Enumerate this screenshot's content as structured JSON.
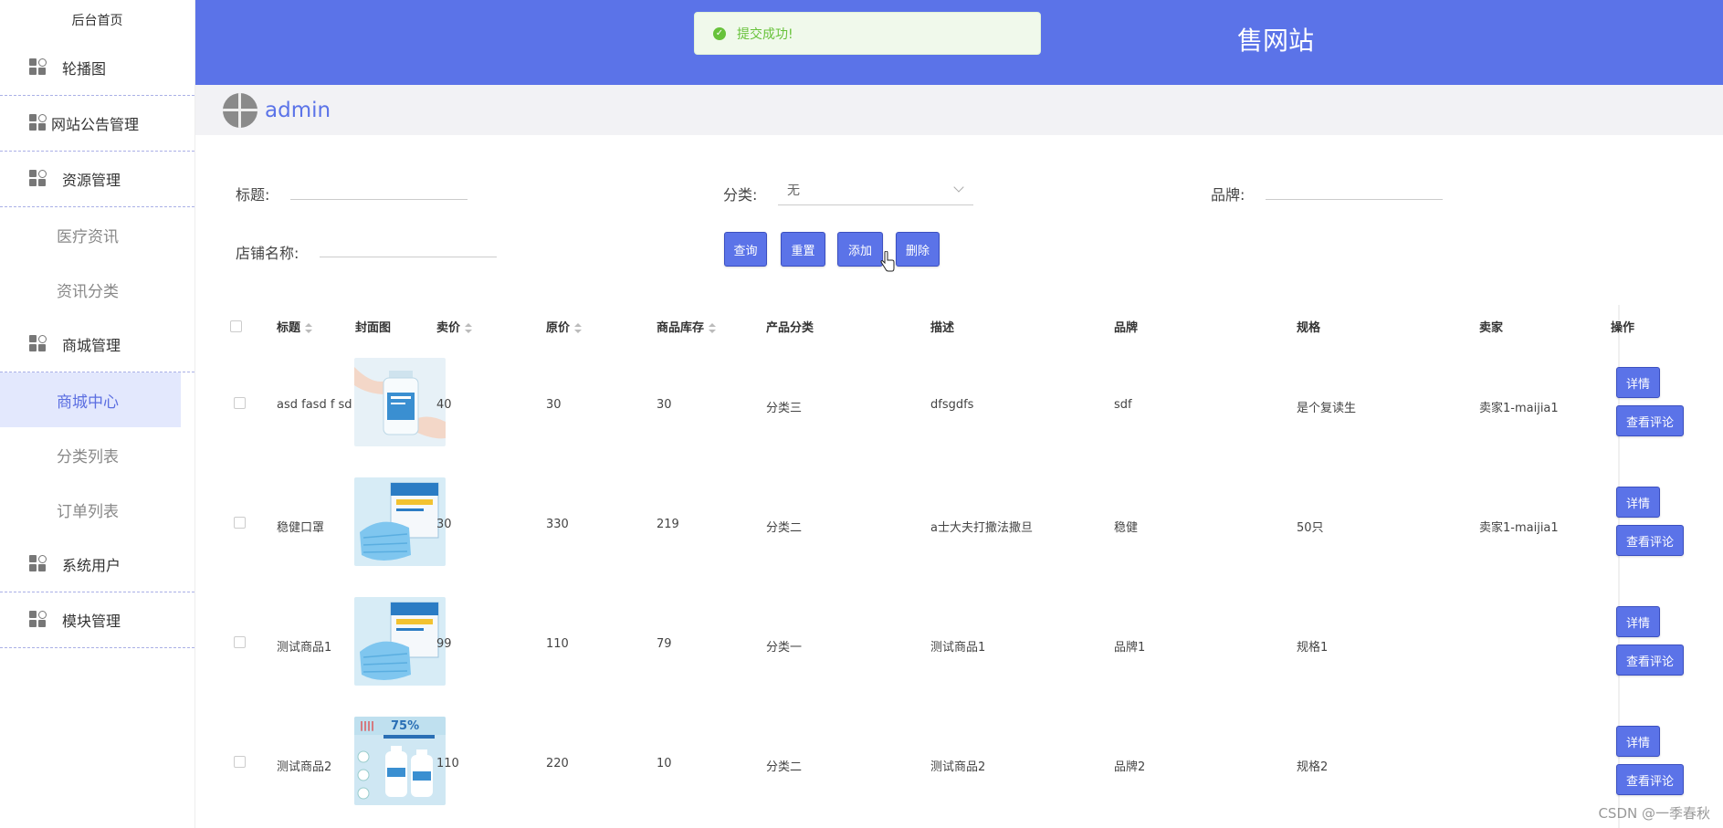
{
  "sidebar": {
    "home": "后台首页",
    "items": [
      {
        "label": "轮播图",
        "icon": "grid-icon",
        "subs": []
      },
      {
        "label": "网站公告管理",
        "icon": "grid-icon",
        "subs": []
      },
      {
        "label": "资源管理",
        "icon": "grid-icon",
        "subs": [
          "医疗资讯",
          "资讯分类"
        ]
      },
      {
        "label": "商城管理",
        "icon": "grid-icon",
        "subs": [
          "商城中心",
          "分类列表",
          "订单列表"
        ]
      },
      {
        "label": "系统用户",
        "icon": "grid-icon",
        "subs": []
      },
      {
        "label": "模块管理",
        "icon": "grid-icon",
        "subs": []
      }
    ],
    "active_sub": "商城中心"
  },
  "header": {
    "title": "售网站",
    "toast": "提交成功!"
  },
  "user": {
    "name": "admin"
  },
  "filters": {
    "title_label": "标题:",
    "category_label": "分类:",
    "category_value": "无",
    "brand_label": "品牌:",
    "shop_label": "店铺名称:"
  },
  "buttons": {
    "query": "查询",
    "reset": "重置",
    "add": "添加",
    "delete": "删除"
  },
  "table": {
    "headers": {
      "title": "标题",
      "cover": "封面图",
      "price": "卖价",
      "original": "原价",
      "stock": "商品库存",
      "category": "产品分类",
      "desc": "描述",
      "brand": "品牌",
      "spec": "规格",
      "seller": "卖家",
      "ops": "操作"
    },
    "rows": [
      {
        "title": "asd fasd f sd",
        "cover": "sanitizer-bottle",
        "price": "40",
        "original": "30",
        "stock": "30",
        "category": "分类三",
        "desc": "dfsgdfs",
        "brand": "sdf",
        "spec": "是个复读生",
        "seller": "卖家1-maijia1"
      },
      {
        "title": "稳健口罩",
        "cover": "mask-box",
        "price": "30",
        "original": "330",
        "stock": "219",
        "category": "分类二",
        "desc": "a士大夫打撒法撒旦",
        "brand": "稳健",
        "spec": "50只",
        "seller": "卖家1-maijia1"
      },
      {
        "title": "测试商品1",
        "cover": "mask-box",
        "price": "99",
        "original": "110",
        "stock": "79",
        "category": "分类一",
        "desc": "测试商品1",
        "brand": "品牌1",
        "spec": "规格1",
        "seller": ""
      },
      {
        "title": "测试商品2",
        "cover": "alcohol-bottles",
        "price": "110",
        "original": "220",
        "stock": "10",
        "category": "分类二",
        "desc": "测试商品2",
        "brand": "品牌2",
        "spec": "规格2",
        "seller": ""
      }
    ],
    "detail_btn": "详情",
    "review_btn": "查看评论"
  },
  "cover_text": {
    "alcohol_promo": "75%"
  },
  "watermark": "CSDN @一季春秋",
  "colors": {
    "primary": "#5b73e8",
    "active_bg": "#e3e8fd",
    "success": "#67c23a"
  }
}
